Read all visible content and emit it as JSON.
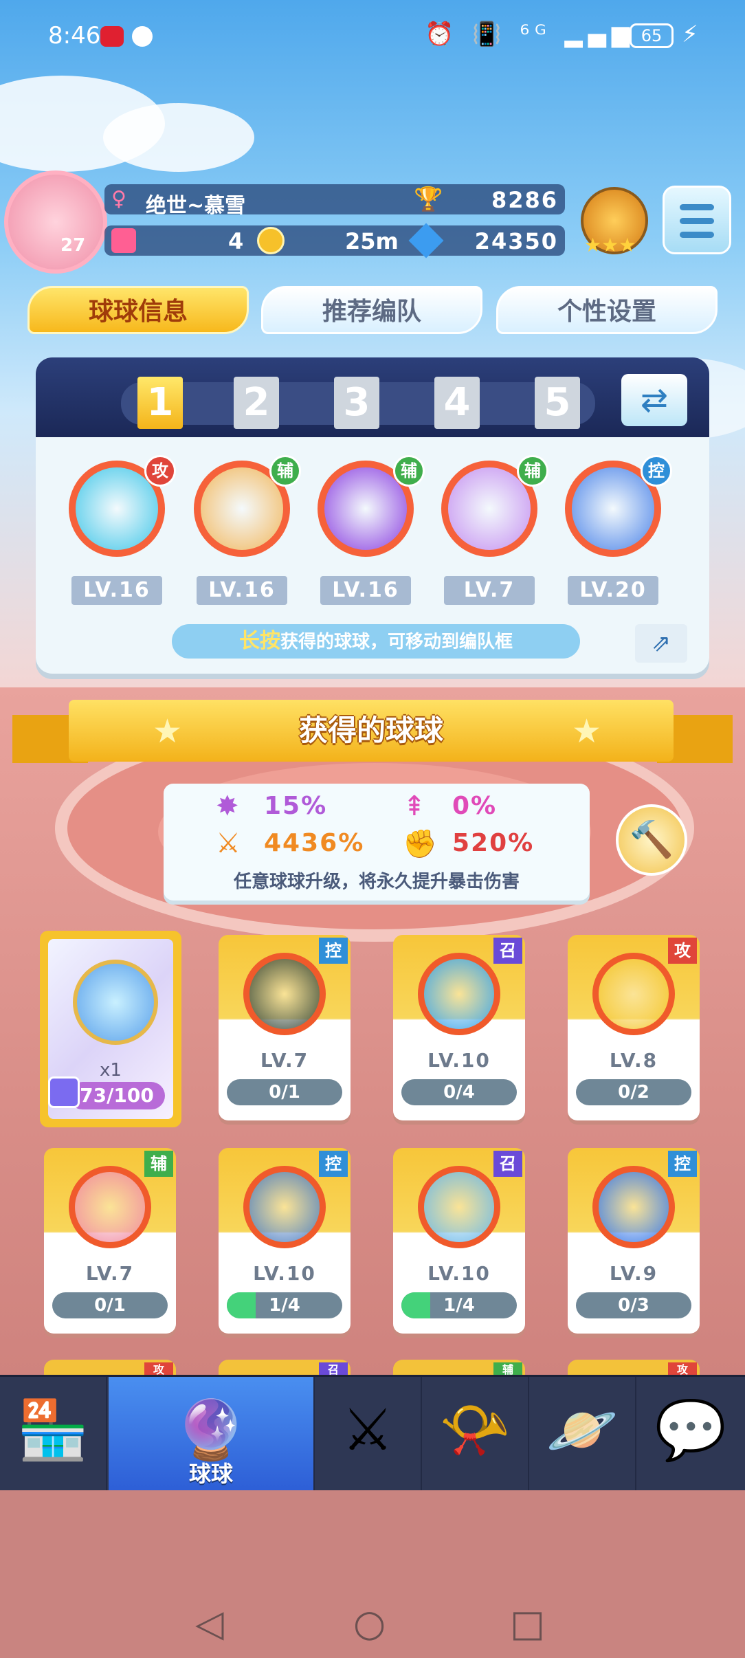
{
  "status_bar": {
    "time": "8:46",
    "icons": "⏰ 📳 ⁶ᴳ ▂▄▆",
    "battery": "65",
    "bolt": "⚡"
  },
  "profile": {
    "level": "27",
    "gender_icon": "♀",
    "name": "绝世~慕雪",
    "trophy_icon": "🏆",
    "trophies": "8286",
    "cards": "4",
    "coins": "25m",
    "gems": "24350",
    "rank_stars": "★★★"
  },
  "tabs": [
    {
      "label": "球球信息",
      "active": true
    },
    {
      "label": "推荐编队",
      "active": false
    },
    {
      "label": "个性设置",
      "active": false
    }
  ],
  "team": {
    "slots": [
      "1",
      "2",
      "3",
      "4",
      "5"
    ],
    "active_slot": "1",
    "swap_icon": "⇄",
    "balls": [
      {
        "role": "攻",
        "role_color": "#e0453a",
        "level": "LV.16",
        "color": "#3fc6e8"
      },
      {
        "role": "辅",
        "role_color": "#3fae4c",
        "level": "LV.16",
        "color": "#f2b65a"
      },
      {
        "role": "辅",
        "role_color": "#3fae4c",
        "level": "LV.16",
        "color": "#8a3ee0"
      },
      {
        "role": "辅",
        "role_color": "#3fae4c",
        "level": "LV.7",
        "color": "#c48ef0"
      },
      {
        "role": "控",
        "role_color": "#2f8fd8",
        "level": "LV.20",
        "color": "#4a82e8"
      }
    ],
    "hint_key": "长按",
    "hint_text": "获得的球球，可移动到编队框",
    "share_icon": "⇗"
  },
  "collection": {
    "title": "获得的球球",
    "star_icon": "★",
    "stats": [
      {
        "icon": "✸",
        "color": "#b05ad8",
        "value": "15%"
      },
      {
        "icon": "⇞",
        "color": "#e04ab8",
        "value": "0%"
      },
      {
        "icon": "⚔",
        "color": "#f08a22",
        "value": "4436%"
      },
      {
        "icon": "✊",
        "color": "#e04040",
        "value": "520%"
      }
    ],
    "stats_note": "任意球球升级，将永久提升暴击伤害",
    "hammer_icon": "🔨"
  },
  "fragment_card": {
    "count": "x1",
    "progress": "73/100",
    "progress_fraction": 0.73
  },
  "cards": [
    {
      "role": "控",
      "role_color": "#2f8fd8",
      "level": "LV.7",
      "progress": "0/1",
      "fill": 0,
      "color": "#3a4a3a"
    },
    {
      "role": "召",
      "role_color": "#6a4ad8",
      "level": "LV.10",
      "progress": "0/4",
      "fill": 0,
      "color": "#3aa4e8"
    },
    {
      "role": "攻",
      "role_color": "#e0453a",
      "level": "LV.8",
      "progress": "0/2",
      "fill": 0,
      "color": "#f4c52a"
    },
    {
      "role": "辅",
      "role_color": "#3fae4c",
      "level": "LV.7",
      "progress": "0/1",
      "fill": 0,
      "color": "#f08aa0"
    },
    {
      "role": "控",
      "role_color": "#2f8fd8",
      "level": "LV.10",
      "progress": "1/4",
      "fill": 0.25,
      "color": "#4f7fc0"
    },
    {
      "role": "召",
      "role_color": "#6a4ad8",
      "level": "LV.10",
      "progress": "1/4",
      "fill": 0.25,
      "color": "#6ab8e8"
    },
    {
      "role": "控",
      "role_color": "#2f8fd8",
      "level": "LV.9",
      "progress": "0/3",
      "fill": 0,
      "color": "#3a7ae8"
    }
  ],
  "peek_badges": [
    "攻",
    "召",
    "辅",
    "攻"
  ],
  "nav": [
    {
      "icon": "shop-icon",
      "glyph": "🏪",
      "label": ""
    },
    {
      "icon": "ball-icon",
      "glyph": "🔮",
      "label": "球球",
      "active": true
    },
    {
      "icon": "battle-icon",
      "glyph": "⚔",
      "label": ""
    },
    {
      "icon": "whistle-icon",
      "glyph": "📯",
      "label": ""
    },
    {
      "icon": "planet-icon",
      "glyph": "🪐",
      "label": ""
    },
    {
      "icon": "chat-icon",
      "glyph": "💬",
      "label": ""
    }
  ],
  "system_nav": {
    "back": "◁",
    "home": "○",
    "recent": "□"
  }
}
